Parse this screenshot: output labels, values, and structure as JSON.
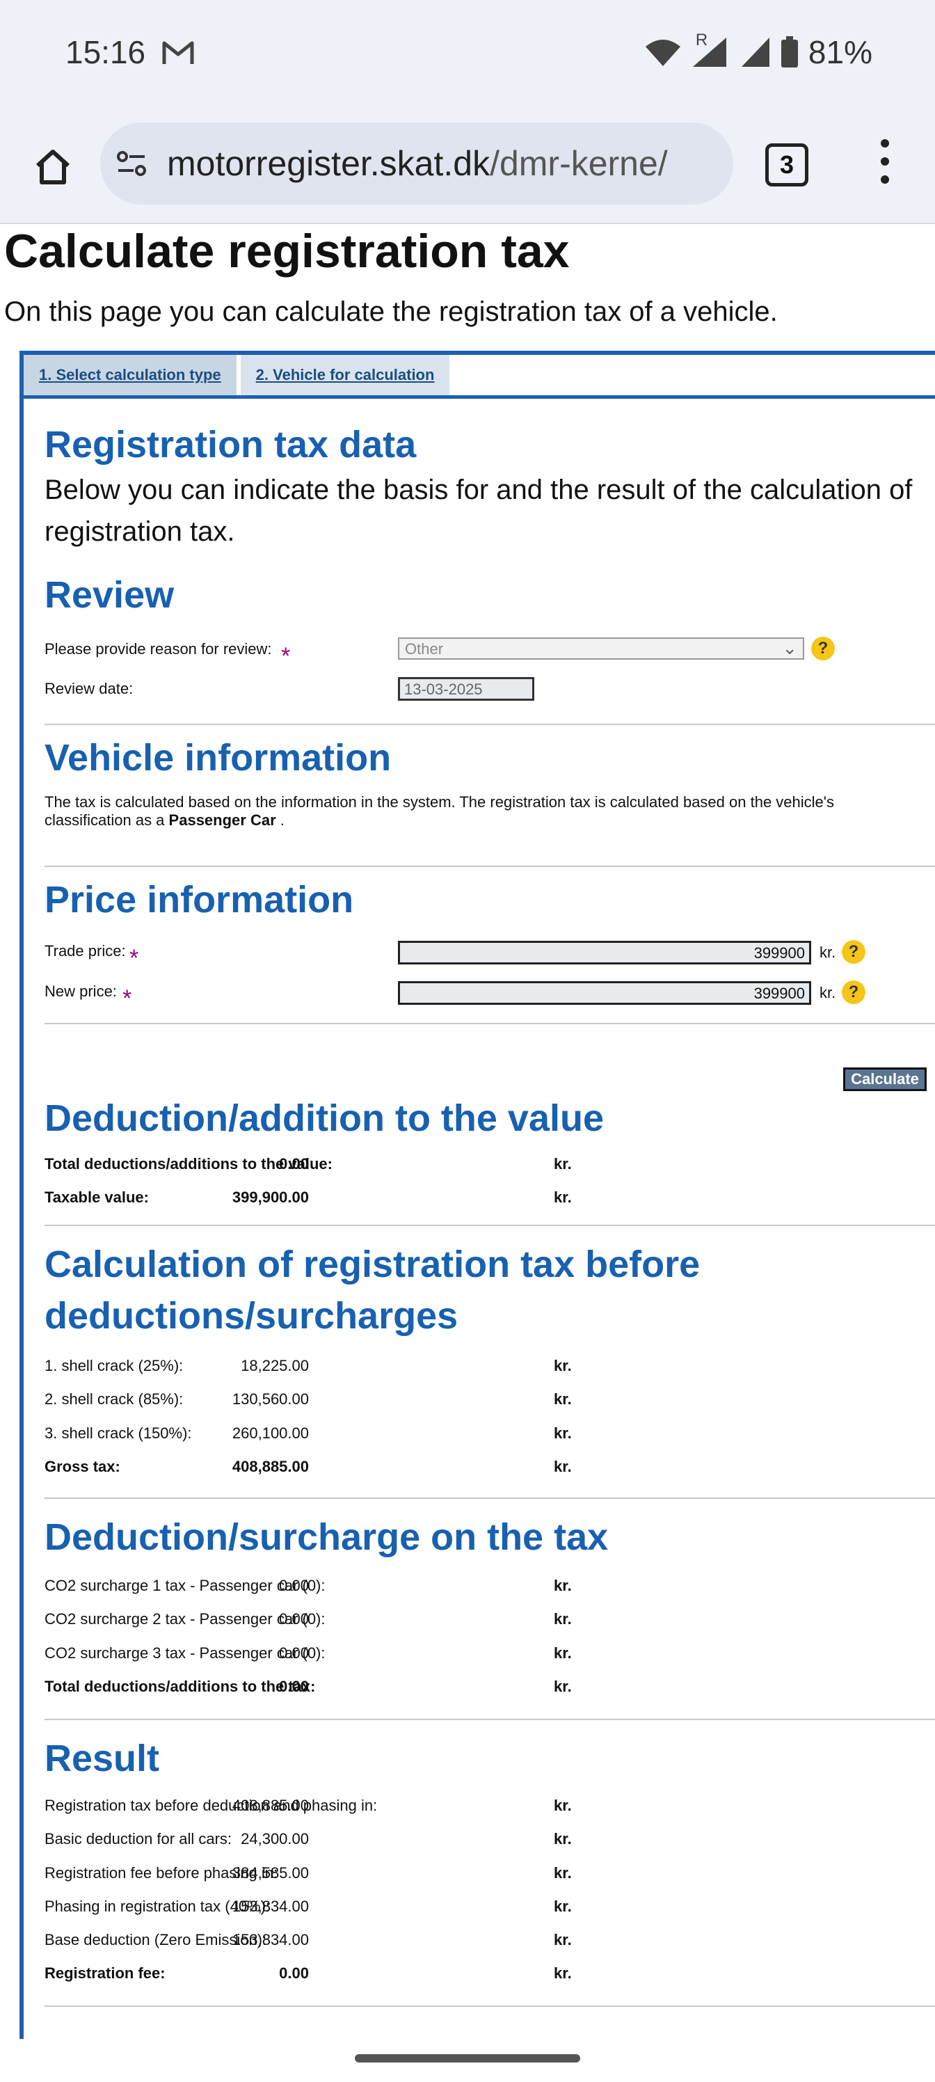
{
  "status": {
    "time": "15:16",
    "battery": "81%",
    "roaming": "R"
  },
  "browser": {
    "url_host": "motorregister.skat.dk",
    "url_rest": "/dmr-kerne/",
    "tab_count": "3"
  },
  "page": {
    "title": "Calculate registration tax",
    "intro": "On this page you can calculate the registration tax of a vehicle."
  },
  "tabs": [
    "1. Select calculation type",
    "2. Vehicle for calculation"
  ],
  "regdata": {
    "title": "Registration tax data",
    "desc": "Below you can indicate the basis for and the result of the calculation of registration tax."
  },
  "review": {
    "title": "Review",
    "reason_label": "Please provide reason for review:",
    "reason_value": "Other",
    "date_label": "Review date:",
    "date_value": "13-03-2025"
  },
  "vehicle": {
    "title": "Vehicle information",
    "text1": "The tax is calculated based on the information in the system. The registration tax is calculated based on the vehicle's",
    "text2": "classification as a",
    "car": "Passenger Car",
    "dot": "."
  },
  "price": {
    "title": "Price information",
    "trade_label": "Trade price:",
    "trade_value": "399900",
    "new_label": "New price:",
    "new_value": "399900",
    "unit": "kr.",
    "calc": "Calculate"
  },
  "deduction_value": {
    "title": "Deduction/addition to the value",
    "rows": [
      {
        "label": "Total deductions/additions to the value:",
        "value": "0.00",
        "unit": "kr."
      },
      {
        "label": "Taxable value:",
        "value": "399,900.00",
        "unit": "kr."
      }
    ]
  },
  "calc_before": {
    "title1": "Calculation of registration tax before",
    "title2": "deductions/surcharges",
    "rows": [
      {
        "label": "1. shell crack (25%):",
        "value": "18,225.00",
        "unit": "kr."
      },
      {
        "label": "2. shell crack (85%):",
        "value": "130,560.00",
        "unit": "kr."
      },
      {
        "label": "3. shell crack (150%):",
        "value": "260,100.00",
        "unit": "kr."
      },
      {
        "label": "Gross tax:",
        "value": "408,885.00",
        "unit": "kr."
      }
    ]
  },
  "surcharge": {
    "title": "Deduction/surcharge on the tax",
    "rows": [
      {
        "label": "CO2 surcharge 1 tax - Passenger car (0):",
        "value": "0.00",
        "unit": "kr."
      },
      {
        "label": "CO2 surcharge 2 tax - Passenger car (0):",
        "value": "0.00",
        "unit": "kr."
      },
      {
        "label": "CO2 surcharge 3 tax - Passenger car (0):",
        "value": "0.00",
        "unit": "kr."
      },
      {
        "label": "Total deductions/additions to the tax:",
        "value": "0.00",
        "unit": "kr."
      }
    ]
  },
  "result": {
    "title": "Result",
    "rows": [
      {
        "label": "Registration tax before deduction and phasing in:",
        "value": "408,885.00",
        "unit": "kr."
      },
      {
        "label": "Basic deduction for all cars:",
        "value": "24,300.00",
        "unit": "kr."
      },
      {
        "label": "Registration fee before phasing in:",
        "value": "384,585.00",
        "unit": "kr."
      },
      {
        "label": "Phasing in registration tax (40%):",
        "value": "153,834.00",
        "unit": "kr."
      },
      {
        "label": "Base deduction (Zero Emission):",
        "value": "153,834.00",
        "unit": "kr."
      },
      {
        "label": "Registration fee:",
        "value": "0.00",
        "unit": "kr."
      }
    ]
  },
  "colors": {
    "accent": "#1860b0",
    "panel_border": "#1d5fb0",
    "help": "#f5c518",
    "required": "#a0007a"
  }
}
